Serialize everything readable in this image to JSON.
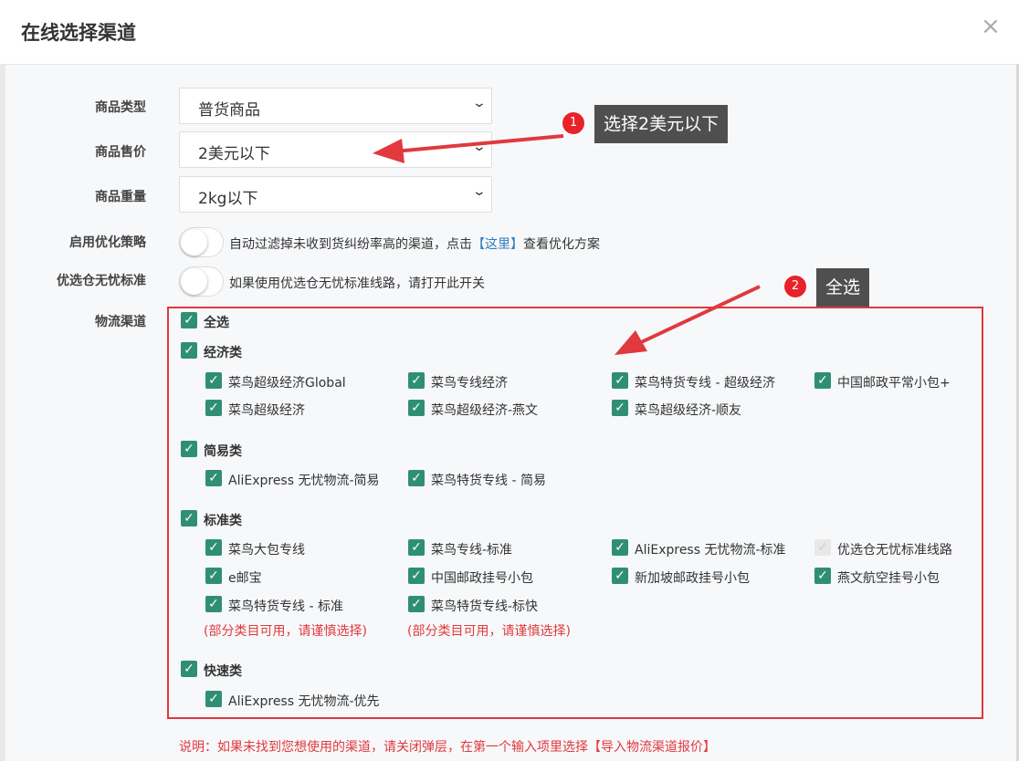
{
  "dialog": {
    "title": "在线选择渠道",
    "close_glyph": "×"
  },
  "form": {
    "product_type": {
      "label": "商品类型",
      "value": "普货商品"
    },
    "price": {
      "label": "商品售价",
      "value": "2美元以下"
    },
    "weight": {
      "label": "商品重量",
      "value": "2kg以下"
    },
    "optimize": {
      "label": "启用优化策略",
      "text_before": "自动过滤掉未收到货纠纷率高的渠道，点击",
      "link": "【这里】",
      "text_after": "查看优化方案",
      "enabled": false
    },
    "worry_free": {
      "label": "优选仓无忧标准",
      "text": "如果使用优选仓无忧标准线路，请打开此开关",
      "enabled": false
    },
    "channels_label": "物流渠道"
  },
  "channels": {
    "select_all": "全选",
    "economy": {
      "label": "经济类",
      "items": [
        "菜鸟超级经济Global",
        "菜鸟专线经济",
        "菜鸟特货专线 - 超级经济",
        "中国邮政平常小包+",
        "菜鸟超级经济",
        "菜鸟超级经济-燕文",
        "菜鸟超级经济-顺友"
      ]
    },
    "simple": {
      "label": "简易类",
      "items": [
        "AliExpress 无忧物流-简易",
        "菜鸟特货专线 - 简易"
      ]
    },
    "standard": {
      "label": "标准类",
      "items": [
        "菜鸟大包专线",
        "菜鸟专线-标准",
        "AliExpress 无忧物流-标准",
        "优选仓无忧标准线路",
        "e邮宝",
        "中国邮政挂号小包",
        "新加坡邮政挂号小包",
        "燕文航空挂号小包",
        "菜鸟特货专线 - 标准",
        "菜鸟特货专线-标快"
      ],
      "notes": [
        "(部分类目可用，请谨慎选择)",
        "(部分类目可用，请谨慎选择)"
      ]
    },
    "express": {
      "label": "快速类",
      "items": [
        "AliExpress 无忧物流-优先"
      ]
    }
  },
  "footnote": "说明：如果未找到您想使用的渠道，请关闭弹层，在第一个输入项里选择【导入物流渠道报价】",
  "annotations": {
    "step1": {
      "number": "1",
      "text": "选择2美元以下"
    },
    "step2": {
      "number": "2",
      "text": "全选"
    }
  },
  "colors": {
    "checkbox": "#2f8f74",
    "annotation_red": "#e0393e",
    "link": "#2f7dbf",
    "tip_bg": "#4f4f4f"
  },
  "glyphs": {
    "check": "✓",
    "chevron": "⌄"
  }
}
